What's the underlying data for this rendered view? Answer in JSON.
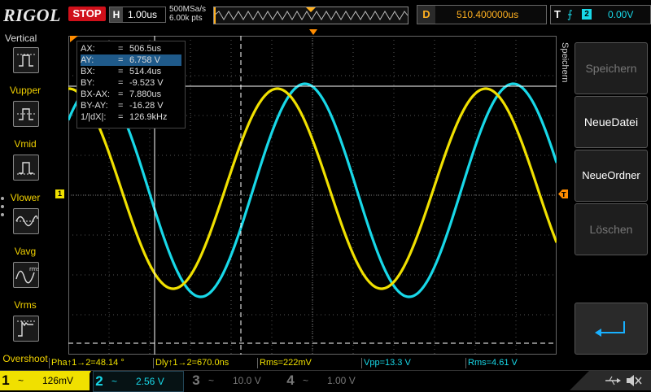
{
  "topbar": {
    "logo": "RIGOL",
    "run_state": "STOP",
    "horizontal_key": "H",
    "timebase": "1.00us",
    "sample_rate": "500MSa/s",
    "memory_depth": "6.00k pts",
    "delay_key": "D",
    "delay": "510.400000us",
    "trigger_key": "T",
    "trigger_edge": "rising-edge-icon",
    "trigger_source": "2",
    "trigger_level": "0.00V"
  },
  "left_menu": {
    "title": "Vertical",
    "items": [
      {
        "label": "Vupper",
        "icon": "vupper-icon"
      },
      {
        "label": "Vmid",
        "icon": "vmid-icon"
      },
      {
        "label": "Vlower",
        "icon": "vlower-icon"
      },
      {
        "label": "Vavg",
        "icon": "vavg-icon"
      },
      {
        "label": "Vrms",
        "icon": "vrms-icon"
      },
      {
        "label": "Overshoot",
        "icon": "overshoot-icon"
      }
    ]
  },
  "right_menu": {
    "title": "Speichern",
    "buttons": [
      {
        "label": "Speichern",
        "enabled": false
      },
      {
        "label": "NeueDatei",
        "enabled": true
      },
      {
        "label": "NeueOrdner",
        "enabled": true
      },
      {
        "label": "Löschen",
        "enabled": false
      },
      {
        "label": "",
        "icon": "enter-icon",
        "enabled": true
      }
    ]
  },
  "cursors": {
    "rows": [
      {
        "k": "AX:",
        "v": "506.5us",
        "highlight": false
      },
      {
        "k": "AY:",
        "v": "6.758 V",
        "highlight": true
      },
      {
        "k": "BX:",
        "v": "514.4us",
        "highlight": false
      },
      {
        "k": "BY:",
        "v": "-9.523 V",
        "highlight": false
      },
      {
        "k": "BX-AX:",
        "v": "7.880us",
        "highlight": false
      },
      {
        "k": "BY-AY:",
        "v": "-16.28 V",
        "highlight": false
      },
      {
        "k": "1/|dX|:",
        "v": "126.9kHz",
        "highlight": false
      }
    ]
  },
  "measurements": [
    {
      "text": "Pha↑1→2=48.14 °",
      "color": "yellow"
    },
    {
      "text": "Dly↑1→2=670.0ns",
      "color": "yellow"
    },
    {
      "text": "Rms=222mV",
      "color": "yellow"
    },
    {
      "text": "Vpp=13.3 V",
      "color": "cyan"
    },
    {
      "text": "Rms=4.61 V",
      "color": "cyan"
    }
  ],
  "channels": [
    {
      "num": "1",
      "coupling": "~",
      "scale": "126mV",
      "active": true
    },
    {
      "num": "2",
      "coupling": "~",
      "scale": "2.56 V",
      "active": true
    },
    {
      "num": "3",
      "coupling": "~",
      "scale": "10.0 V",
      "active": false
    },
    {
      "num": "4",
      "coupling": "~",
      "scale": "1.00 V",
      "active": false
    }
  ],
  "markers": {
    "ch1_ground": "1",
    "trigger_pos": "T"
  },
  "colors": {
    "ch1": "#f0e000",
    "ch2": "#18d8e8",
    "stop": "#d0101a",
    "delay": "#ffb020",
    "marker": "#ff8c00"
  }
}
